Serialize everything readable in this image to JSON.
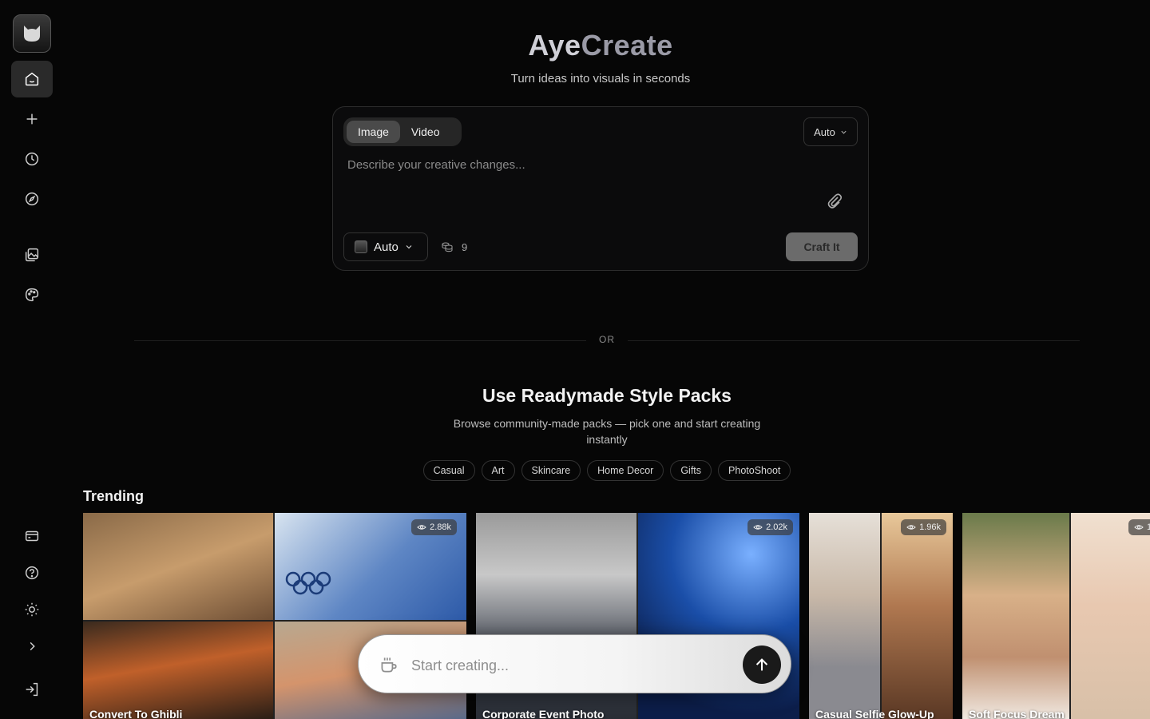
{
  "app": {
    "title_part1": "Aye",
    "title_part2": "Create",
    "tagline": "Turn ideas into visuals in seconds"
  },
  "sidebar": {
    "top_items": [
      {
        "name": "home-icon",
        "active": true
      },
      {
        "name": "plus-icon"
      },
      {
        "name": "clock-icon"
      },
      {
        "name": "compass-icon"
      },
      {
        "name": "gallery-icon"
      },
      {
        "name": "palette-icon"
      }
    ],
    "bottom_items": [
      {
        "name": "card-icon"
      },
      {
        "name": "help-icon"
      },
      {
        "name": "sun-icon"
      },
      {
        "name": "chevron-right-icon"
      },
      {
        "name": "login-icon"
      }
    ]
  },
  "composer": {
    "tabs": [
      {
        "label": "Image",
        "active": true
      },
      {
        "label": "Video"
      }
    ],
    "ratio_label": "Auto",
    "placeholder": "Describe your creative changes...",
    "model_label": "Auto",
    "credits": "9",
    "submit_label": "Craft It"
  },
  "divider": {
    "label": "OR"
  },
  "packs": {
    "title": "Use Readymade Style Packs",
    "subtitle": "Browse community-made packs — pick one and start creating instantly",
    "chips": [
      "Casual",
      "Art",
      "Skincare",
      "Home Decor",
      "Gifts",
      "PhotoShoot"
    ]
  },
  "trending": {
    "heading": "Trending",
    "cards": [
      {
        "title": "Convert To Ghibli",
        "views": "2.88k"
      },
      {
        "title": "Corporate Event Photo",
        "views": "2.02k"
      },
      {
        "title": "Casual Selfie Glow-Up",
        "views": "1.96k"
      },
      {
        "title": "Soft Focus Dream",
        "views": "1"
      }
    ]
  },
  "floating_bar": {
    "placeholder": "Start creating..."
  },
  "colors": {
    "background": "#060606",
    "accent_button": "#6b6b6b",
    "active_nav": "#2a2a2a"
  }
}
